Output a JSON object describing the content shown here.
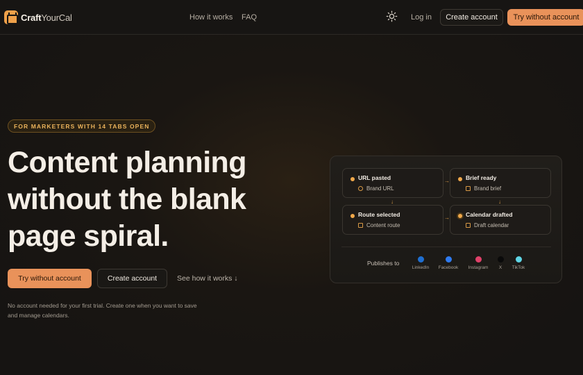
{
  "nav": {
    "brand_bold": "Craft",
    "brand_light": "YourCal",
    "links": [
      "How it works",
      "FAQ"
    ],
    "theme_icon": "sun-icon",
    "login": "Log in",
    "create_account": "Create account",
    "try_without": "Try without account"
  },
  "hero": {
    "eyebrow": "FOR MARKETERS WITH 14 TABS OPEN",
    "headline_lines": [
      "Content planning",
      "without the blank",
      "page spiral."
    ],
    "cta_primary": "Try without account",
    "cta_secondary": "Create account",
    "cta_link": "See how it works ↓",
    "footnote": "No account needed for your first trial. Create one when you want to save and manage calendars."
  },
  "flow": {
    "steps": [
      {
        "title": "URL pasted",
        "sub": "Brand URL",
        "icon": "globe-icon"
      },
      {
        "title": "Brief ready",
        "sub": "Brand brief",
        "icon": "document-icon"
      },
      {
        "title": "Route selected",
        "sub": "Content route",
        "icon": "route-icon"
      },
      {
        "title": "Calendar drafted",
        "sub": "Draft calendar",
        "icon": "calendar-icon"
      }
    ],
    "arrow_right": "→",
    "arrow_down": "↓",
    "publishes_label": "Publishes to",
    "platforms": [
      {
        "name": "LinkedIn",
        "color": "#1f6fd1"
      },
      {
        "name": "Facebook",
        "color": "#2f7bf0"
      },
      {
        "name": "Instagram",
        "color": "#e0416a"
      },
      {
        "name": "X",
        "color": "#0a0a0a"
      },
      {
        "name": "TikTok",
        "color": "#5fd6e6"
      }
    ]
  },
  "colors": {
    "accent": "#e9925a",
    "gold": "#f0a84a",
    "background": "#161412"
  }
}
